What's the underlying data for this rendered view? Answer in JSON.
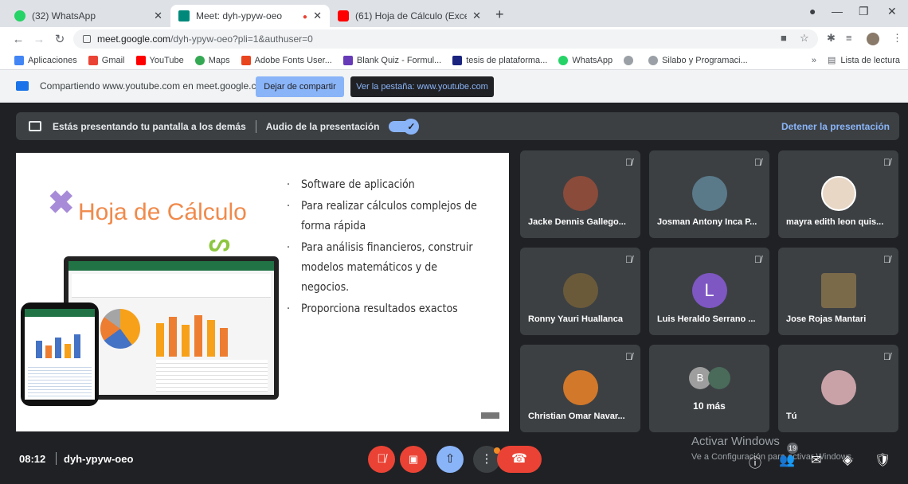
{
  "tabs": [
    {
      "title": "(32) WhatsApp",
      "color": "#25d366"
    },
    {
      "title": "Meet: dyh-ypyw-oeo",
      "color": "#00897b"
    },
    {
      "title": "(61) Hoja de Cálculo (Excel) (",
      "color": "#ff0000"
    }
  ],
  "address": {
    "host": "meet.google.com",
    "path": "/dyh-ypyw-oeo?pli=1&authuser=0"
  },
  "bookmarks": [
    {
      "label": "Aplicaciones",
      "color": "#4285f4"
    },
    {
      "label": "Gmail",
      "color": "#ea4335"
    },
    {
      "label": "YouTube",
      "color": "#ff0000"
    },
    {
      "label": "Maps",
      "color": "#34a853"
    },
    {
      "label": "Adobe Fonts User...",
      "color": "#e8441e"
    },
    {
      "label": "Blank Quiz - Formul...",
      "color": "#673ab7"
    },
    {
      "label": "tesis de plataforma...",
      "color": "#1a237e"
    },
    {
      "label": "WhatsApp",
      "color": "#25d366"
    },
    {
      "label": "",
      "color": "#9aa0a6"
    },
    {
      "label": "Silabo y Programaci...",
      "color": "#9aa0a6"
    }
  ],
  "reading_list": "Lista de lectura",
  "sharing": {
    "text": "Compartiendo www.youtube.com en meet.google.com",
    "stop_btn": "Dejar de compartir",
    "goto_btn": "Ver la pestaña: www.youtube.com"
  },
  "presenting": {
    "text": "Estás presentando tu pantalla a los demás",
    "audio": "Audio de la presentación",
    "stop": "Detener la presentación"
  },
  "slide": {
    "title": "Hoja de Cálculo",
    "bullets": [
      "Software de aplicación",
      "Para realizar cálculos complejos de forma rápida",
      "Para análisis financieros, construir modelos matemáticos y de negocios.",
      "Proporciona resultados exactos"
    ]
  },
  "participants": [
    {
      "name": "Jacke Dennis Gallego...",
      "color": "#8a4b3a"
    },
    {
      "name": "Josman Antony Inca P...",
      "color": "#5a7a8a"
    },
    {
      "name": "mayra edith leon quis...",
      "color": "#e8d7c5"
    },
    {
      "name": "Ronny Yauri Huallanca",
      "color": "#6b5a3a"
    },
    {
      "name": "Luis Heraldo Serrano ...",
      "letter": "L"
    },
    {
      "name": "Jose Rojas Mantari",
      "color": "#7a6a4a"
    },
    {
      "name": "Christian Omar Navar...",
      "color": "#d2782a"
    },
    {
      "name": "10 más",
      "letter": "B"
    },
    {
      "name": "Tú",
      "color": "#c9a2a8"
    }
  ],
  "meeting": {
    "time": "08:12",
    "code": "dyh-ypyw-oeo",
    "count": "19"
  },
  "watermark": {
    "line1": "Activar Windows",
    "line2": "Ve a Configuración para activar Windows."
  }
}
